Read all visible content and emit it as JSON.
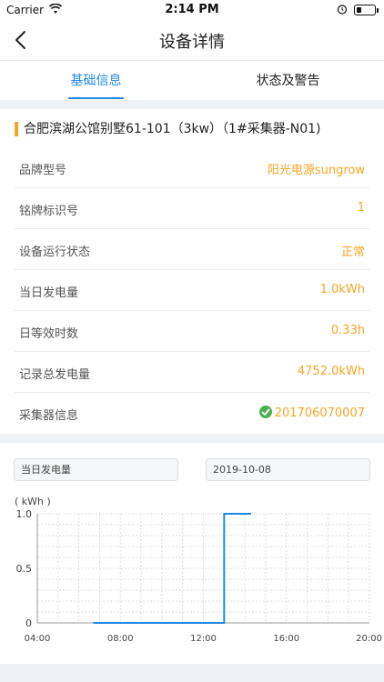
{
  "status_bar": {
    "carrier": "Carrier",
    "time": "2:14 PM",
    "wifi_icon": "wifi-icon",
    "battery_icon": "battery-icon"
  },
  "nav": {
    "title": "设备详情",
    "back_icon": "chevron-left-icon"
  },
  "tabs": [
    {
      "label": "基础信息",
      "active": true
    },
    {
      "label": "状态及警告",
      "active": false
    }
  ],
  "device": {
    "title": "合肥滨湖公馆别墅61-101（3kw）（1#采集器-N01)",
    "rows": [
      {
        "label": "品牌型号",
        "value": "阳光电源sungrow"
      },
      {
        "label": "铭牌标识号",
        "value": "1"
      },
      {
        "label": "设备运行状态",
        "value": "正常"
      },
      {
        "label": "当日发电量",
        "value": "1.0kWh"
      },
      {
        "label": "日等效时数",
        "value": "0.33h"
      },
      {
        "label": "记录总发电量",
        "value": "4752.0kWh"
      },
      {
        "label": "采集器信息",
        "value": "201706070007",
        "icon": "check-circle-icon"
      }
    ]
  },
  "chart_controls": {
    "metric": "当日发电量",
    "date": "2019-10-08"
  },
  "colors": {
    "accent": "#1e88e5",
    "value": "#f5a623",
    "ok": "#4caf50"
  },
  "chart_data": {
    "type": "line",
    "unit_label": "( kWh )",
    "x_ticks": [
      "04:00",
      "08:00",
      "12:00",
      "16:00",
      "20:00"
    ],
    "y_ticks": [
      "1.0",
      "0.5",
      "0"
    ],
    "xlim": [
      4,
      20
    ],
    "ylim": [
      0,
      1.0
    ],
    "series": [
      {
        "points": [
          [
            6.7,
            0
          ],
          [
            13.0,
            0
          ],
          [
            13.0,
            1.0
          ],
          [
            14.3,
            1.0
          ]
        ]
      }
    ],
    "grid": true
  }
}
